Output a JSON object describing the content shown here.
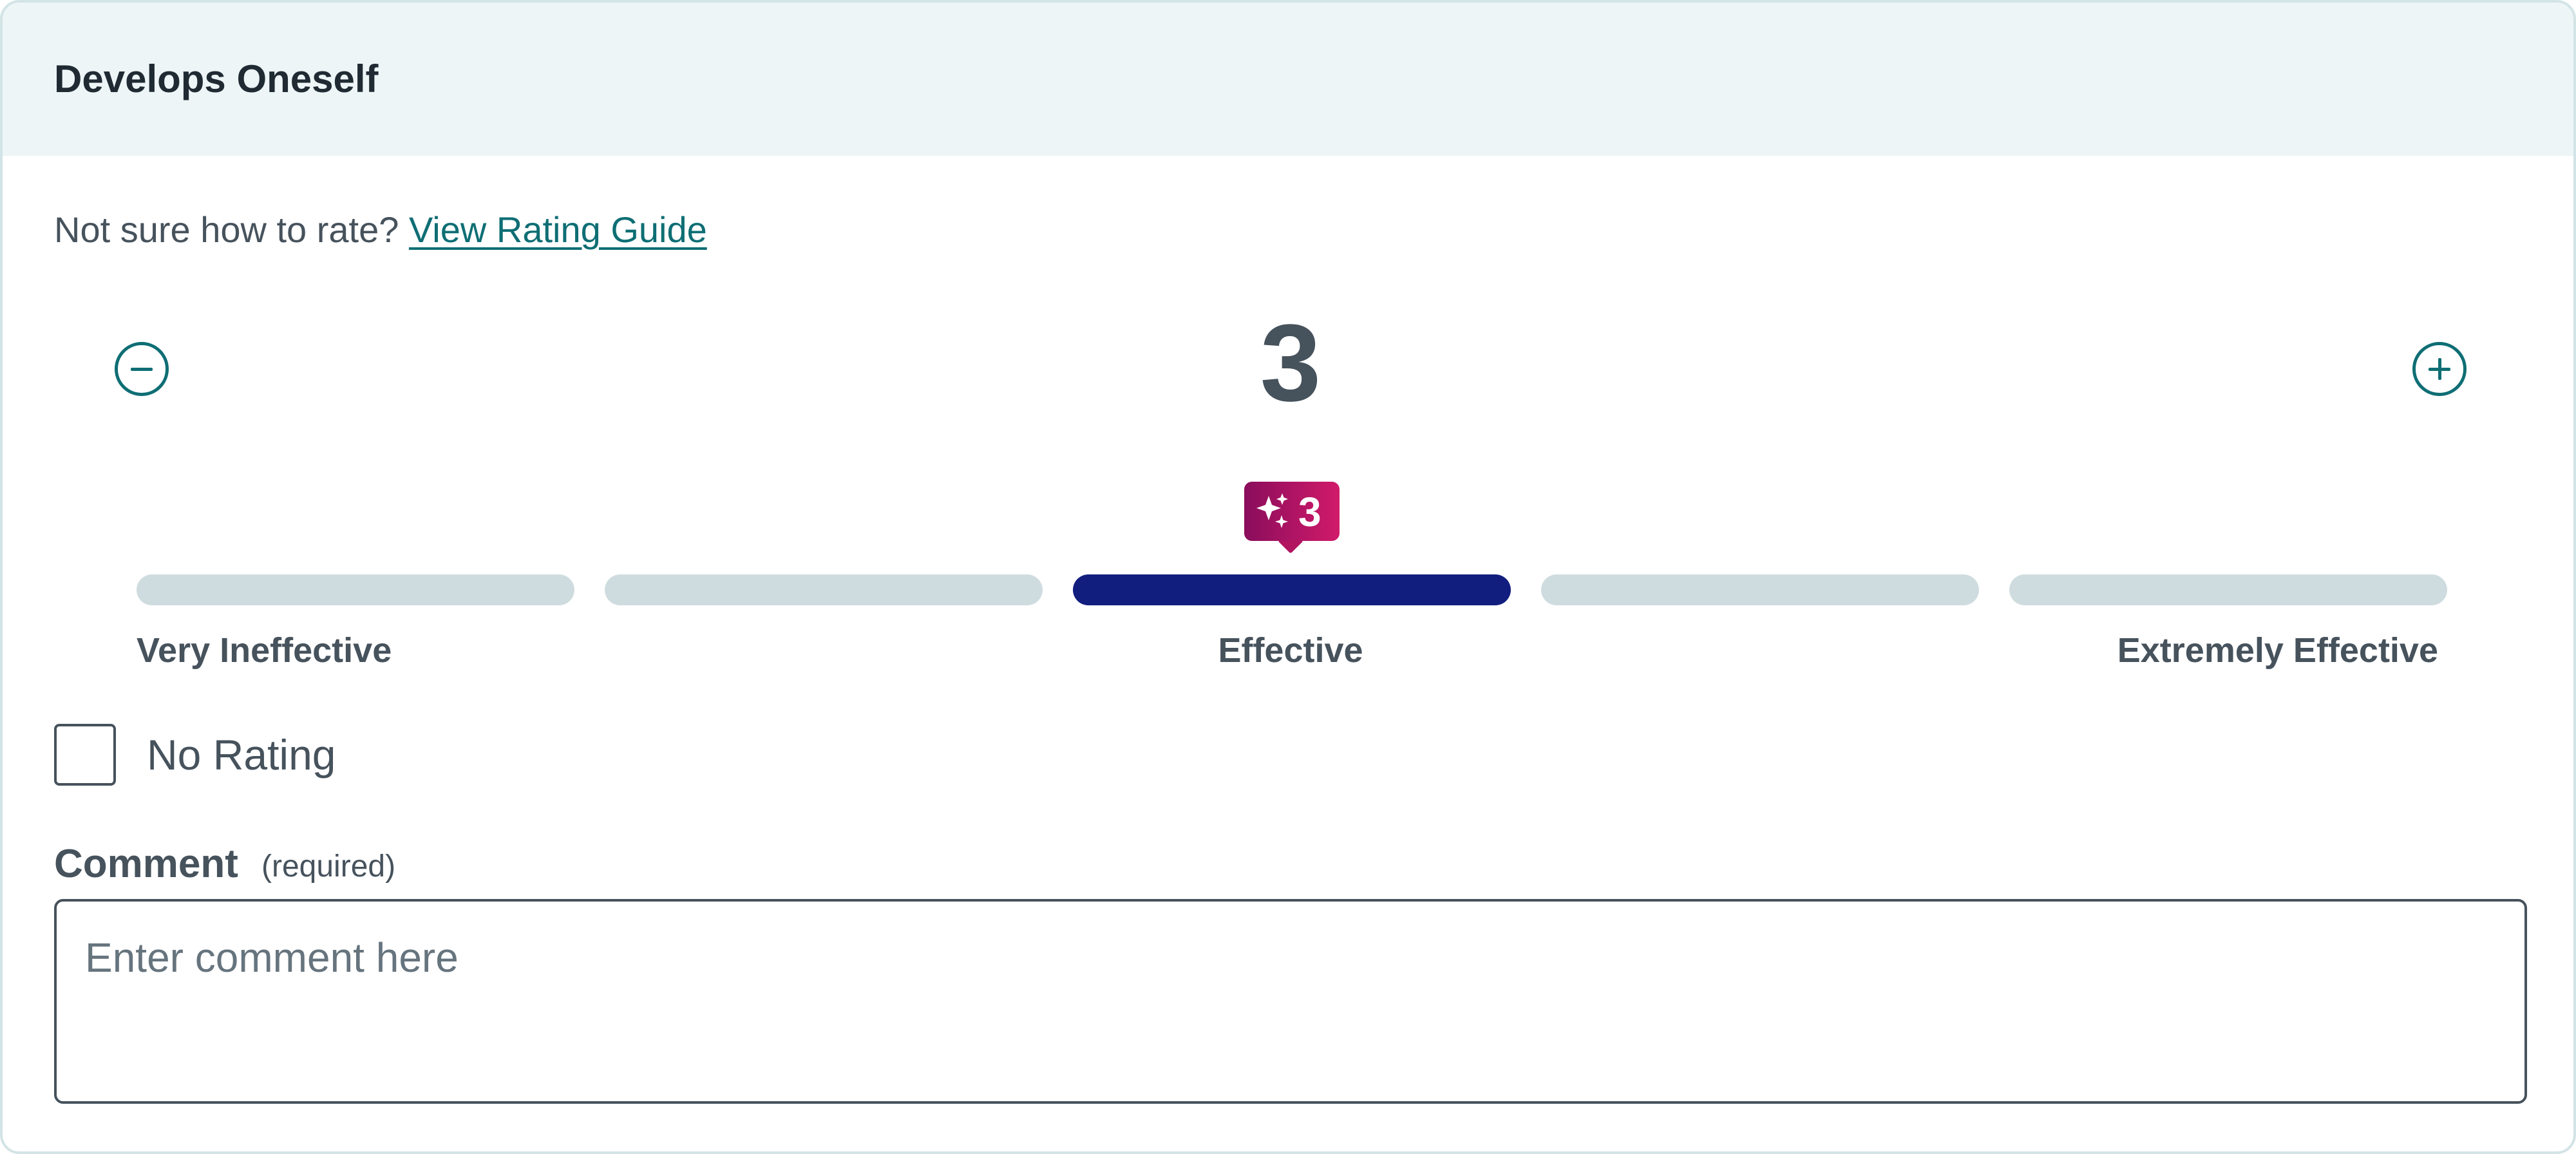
{
  "card": {
    "title": "Develops Oneself"
  },
  "guide": {
    "prompt": "Not sure how to rate?",
    "link_label": "View Rating Guide"
  },
  "rating": {
    "value": "3",
    "min_value": 1,
    "max_value": 5,
    "selected_segment": 3,
    "badge_value": "3",
    "badge_icon": "sparkles-icon",
    "minus_icon": "minus-circle-icon",
    "plus_icon": "plus-circle-icon",
    "segments": [
      1,
      2,
      3,
      4,
      5
    ],
    "labels": {
      "low": "Very Ineffective",
      "mid": "Effective",
      "high": "Extremely Effective"
    },
    "colors": {
      "selected": "#121e7e",
      "unselected": "#cfdcdf",
      "accent": "#0e6e74",
      "badge_start": "#8a0d5c",
      "badge_end": "#d11a6a"
    }
  },
  "no_rating": {
    "label": "No Rating",
    "checked": false
  },
  "comment": {
    "label": "Comment",
    "required_note": "(required)",
    "placeholder": "Enter comment here",
    "value": ""
  }
}
